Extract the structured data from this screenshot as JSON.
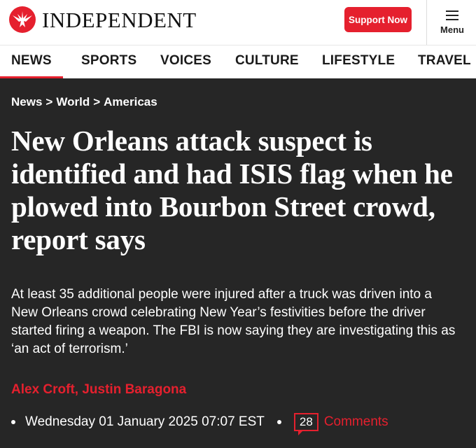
{
  "header": {
    "logo_text": "INDEPENDENT",
    "logo_icon": "eagle-logo-icon",
    "support_label": "Support Now",
    "menu_label": "Menu",
    "menu_icon": "hamburger-icon"
  },
  "nav": {
    "items": [
      {
        "label": "NEWS"
      },
      {
        "label": "SPORTS"
      },
      {
        "label": "VOICES"
      },
      {
        "label": "CULTURE"
      },
      {
        "label": "LIFESTYLE"
      },
      {
        "label": "TRAVEL"
      }
    ],
    "active": "NEWS"
  },
  "article": {
    "breadcrumb": [
      "News",
      "World",
      "Americas"
    ],
    "breadcrumb_separator": ">",
    "headline": "New Orleans attack suspect is identified and had ISIS flag when he plowed into Bourbon Street crowd, report says",
    "standfirst": "At least 35 additional people were injured after a truck was driven into a New Orleans crowd celebrating New Year’s festivities before the driver started firing a weapon. The FBI is now saying they are investigating this as ‘an act of terrorism.’",
    "authors": [
      "Alex Croft",
      "Justin Baragona"
    ],
    "author_separator": ",",
    "date": "Wednesday 01 January 2025 07:07 EST",
    "comments_count": "28",
    "comments_label": "Comments"
  },
  "colors": {
    "accent": "#e5202e",
    "article_bg": "#262626",
    "header_bg": "#ffffff"
  }
}
